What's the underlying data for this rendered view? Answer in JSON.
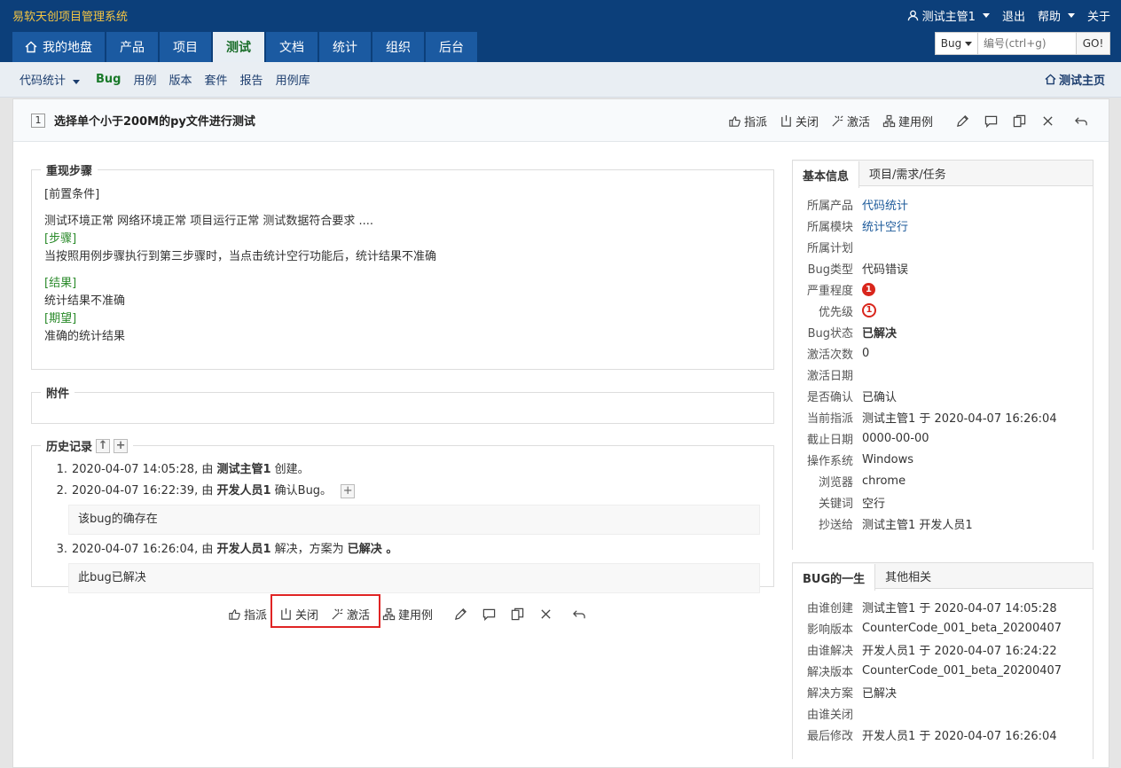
{
  "app": {
    "title": "易软天创项目管理系统"
  },
  "userbar": {
    "user": "测试主管1",
    "logout": "退出",
    "help": "帮助",
    "about": "关于"
  },
  "nav": {
    "tabs": [
      "我的地盘",
      "产品",
      "项目",
      "测试",
      "文档",
      "统计",
      "组织",
      "后台"
    ],
    "active": "测试"
  },
  "search": {
    "type": "Bug",
    "placeholder": "编号(ctrl+g)",
    "go": "GO!"
  },
  "subnav": {
    "product": "代码统计",
    "items": [
      "Bug",
      "用例",
      "版本",
      "套件",
      "报告",
      "用例库"
    ],
    "home": "测试主页"
  },
  "bug": {
    "id": "1",
    "title": "选择单个小于200M的py文件进行测试"
  },
  "actions": {
    "assign": "指派",
    "close": "关闭",
    "activate": "激活",
    "create_case": "建用例"
  },
  "steps": {
    "legend": "重现步骤",
    "precondition_label": "[前置条件]",
    "precondition": "测试环境正常 网络环境正常 项目运行正常 测试数据符合要求 ....",
    "steps_label": "[步骤]",
    "steps": "当按照用例步骤执行到第三步骤时，当点击统计空行功能后，统计结果不准确",
    "result_label": "[结果]",
    "result": "统计结果不准确",
    "expect_label": "[期望]",
    "expect": "准确的统计结果"
  },
  "attachments": {
    "legend": "附件"
  },
  "history": {
    "legend": "历史记录",
    "entries": [
      {
        "num": "1.",
        "time": "2020-04-07 14:05:28, 由 ",
        "actor": "测试主管1",
        "action": " 创建。",
        "comment": ""
      },
      {
        "num": "2.",
        "time": "2020-04-07 16:22:39, 由 ",
        "actor": "开发人员1",
        "action": " 确认Bug。",
        "comment": "该bug的确存在"
      },
      {
        "num": "3.",
        "time": "2020-04-07 16:26:04, 由 ",
        "actor": "开发人员1",
        "action": " 解决，方案为 ",
        "extra": "已解决",
        "tail": " 。",
        "comment": "此bug已解决"
      }
    ]
  },
  "info": {
    "tab_basic": "基本信息",
    "tab_project": "项目/需求/任务",
    "rows": [
      {
        "label": "所属产品",
        "value": "代码统计"
      },
      {
        "label": "所属模块",
        "value": "统计空行"
      },
      {
        "label": "所属计划",
        "value": ""
      },
      {
        "label": "Bug类型",
        "value": "代码错误"
      },
      {
        "label": "严重程度",
        "value": "1"
      },
      {
        "label": "优先级",
        "value": "1"
      },
      {
        "label": "Bug状态",
        "value": "已解决"
      },
      {
        "label": "激活次数",
        "value": "0"
      },
      {
        "label": "激活日期",
        "value": ""
      },
      {
        "label": "是否确认",
        "value": "已确认"
      },
      {
        "label": "当前指派",
        "value": "测试主管1 于 2020-04-07 16:26:04"
      },
      {
        "label": "截止日期",
        "value": "0000-00-00"
      },
      {
        "label": "操作系统",
        "value": "Windows"
      },
      {
        "label": "浏览器",
        "value": "chrome"
      },
      {
        "label": "关键词",
        "value": "空行"
      },
      {
        "label": "抄送给",
        "value": "测试主管1 开发人员1"
      }
    ]
  },
  "life": {
    "tab_life": "BUG的一生",
    "tab_other": "其他相关",
    "rows": [
      {
        "label": "由谁创建",
        "value": "测试主管1 于 2020-04-07 14:05:28"
      },
      {
        "label": "影响版本",
        "value": "CounterCode_001_beta_20200407"
      },
      {
        "label": "由谁解决",
        "value": "开发人员1 于 2020-04-07 16:24:22"
      },
      {
        "label": "解决版本",
        "value": "CounterCode_001_beta_20200407"
      },
      {
        "label": "解决方案",
        "value": "已解决"
      },
      {
        "label": "由谁关闭",
        "value": ""
      },
      {
        "label": "最后修改",
        "value": "开发人员1 于 2020-04-07 16:26:04"
      }
    ]
  },
  "colors": {
    "header": "#0c3f7a",
    "tab": "#1b5aa1",
    "active_green": "#1a7a2a",
    "severity": "#d9261c",
    "highlight": "#e02424"
  }
}
